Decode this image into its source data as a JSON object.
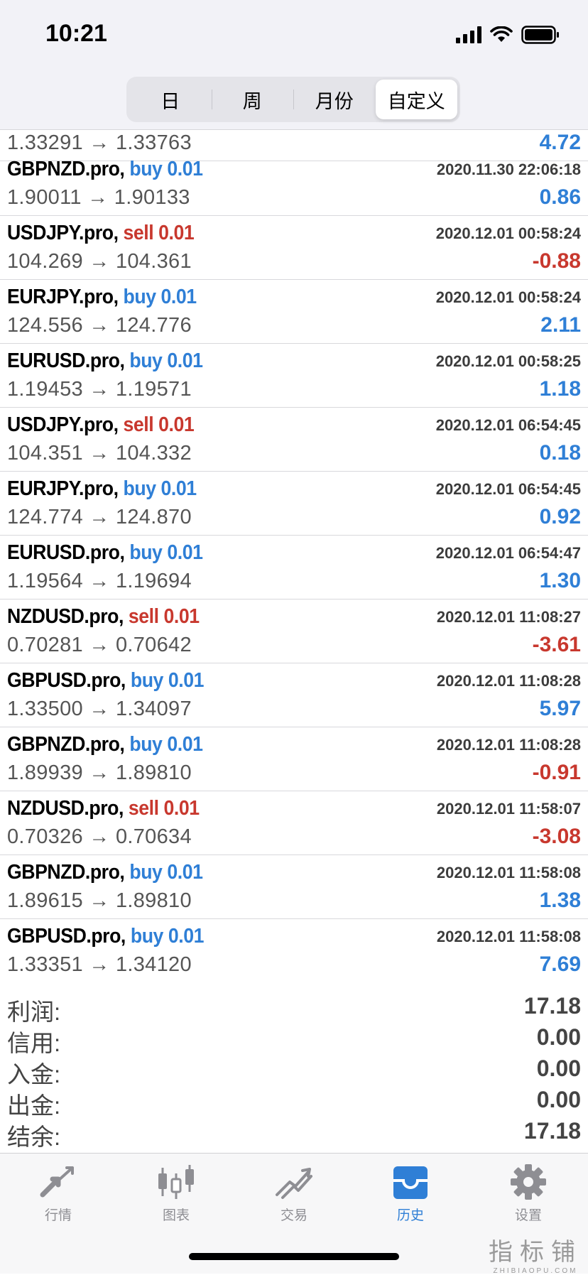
{
  "status": {
    "time": "10:21"
  },
  "tabs": [
    "日",
    "周",
    "月份",
    "自定义"
  ],
  "partial_row": {
    "prices": "1.33291 → 1.33763",
    "profit": "4.72"
  },
  "deals": [
    {
      "symbol": "GBPNZD.pro,",
      "side": "buy",
      "volume": "0.01",
      "time": "2020.11.30 22:06:18",
      "prices": "1.90011 → 1.90133",
      "profit": "0.86"
    },
    {
      "symbol": "USDJPY.pro,",
      "side": "sell",
      "volume": "0.01",
      "time": "2020.12.01 00:58:24",
      "prices": "104.269 → 104.361",
      "profit": "-0.88"
    },
    {
      "symbol": "EURJPY.pro,",
      "side": "buy",
      "volume": "0.01",
      "time": "2020.12.01 00:58:24",
      "prices": "124.556 → 124.776",
      "profit": "2.11"
    },
    {
      "symbol": "EURUSD.pro,",
      "side": "buy",
      "volume": "0.01",
      "time": "2020.12.01 00:58:25",
      "prices": "1.19453 → 1.19571",
      "profit": "1.18"
    },
    {
      "symbol": "USDJPY.pro,",
      "side": "sell",
      "volume": "0.01",
      "time": "2020.12.01 06:54:45",
      "prices": "104.351 → 104.332",
      "profit": "0.18"
    },
    {
      "symbol": "EURJPY.pro,",
      "side": "buy",
      "volume": "0.01",
      "time": "2020.12.01 06:54:45",
      "prices": "124.774 → 124.870",
      "profit": "0.92"
    },
    {
      "symbol": "EURUSD.pro,",
      "side": "buy",
      "volume": "0.01",
      "time": "2020.12.01 06:54:47",
      "prices": "1.19564 → 1.19694",
      "profit": "1.30"
    },
    {
      "symbol": "NZDUSD.pro,",
      "side": "sell",
      "volume": "0.01",
      "time": "2020.12.01 11:08:27",
      "prices": "0.70281 → 0.70642",
      "profit": "-3.61"
    },
    {
      "symbol": "GBPUSD.pro,",
      "side": "buy",
      "volume": "0.01",
      "time": "2020.12.01 11:08:28",
      "prices": "1.33500 → 1.34097",
      "profit": "5.97"
    },
    {
      "symbol": "GBPNZD.pro,",
      "side": "buy",
      "volume": "0.01",
      "time": "2020.12.01 11:08:28",
      "prices": "1.89939 → 1.89810",
      "profit": "-0.91"
    },
    {
      "symbol": "NZDUSD.pro,",
      "side": "sell",
      "volume": "0.01",
      "time": "2020.12.01 11:58:07",
      "prices": "0.70326 → 0.70634",
      "profit": "-3.08"
    },
    {
      "symbol": "GBPNZD.pro,",
      "side": "buy",
      "volume": "0.01",
      "time": "2020.12.01 11:58:08",
      "prices": "1.89615 → 1.89810",
      "profit": "1.38"
    },
    {
      "symbol": "GBPUSD.pro,",
      "side": "buy",
      "volume": "0.01",
      "time": "2020.12.01 11:58:08",
      "prices": "1.33351 → 1.34120",
      "profit": "7.69"
    }
  ],
  "summary": [
    {
      "label": "利润:",
      "value": "17.18"
    },
    {
      "label": "信用:",
      "value": "0.00"
    },
    {
      "label": "入金:",
      "value": "0.00"
    },
    {
      "label": "出金:",
      "value": "0.00"
    },
    {
      "label": "结余:",
      "value": "17.18"
    }
  ],
  "tabbar": [
    {
      "label": "行情",
      "icon": "quotes-icon"
    },
    {
      "label": "图表",
      "icon": "chart-icon"
    },
    {
      "label": "交易",
      "icon": "trade-icon"
    },
    {
      "label": "历史",
      "icon": "history-icon",
      "active": true
    },
    {
      "label": "设置",
      "icon": "settings-icon"
    }
  ],
  "watermark": {
    "cn": "指标铺",
    "en": "ZHIBIAOPU.COM"
  },
  "colors": {
    "buy": "#2f7fd6",
    "sell": "#c8382e",
    "active_tab": "#2f7fd6",
    "inactive_tab": "#8e8e93"
  }
}
